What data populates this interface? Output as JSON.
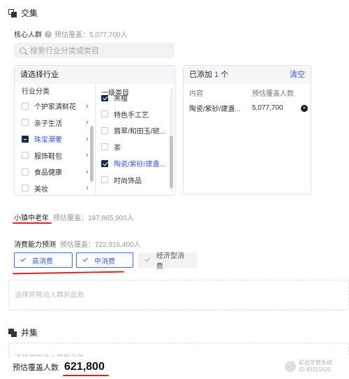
{
  "intersect": {
    "title": "交集"
  },
  "core": {
    "label": "核心人群",
    "help": "?",
    "estimate": "预估覆盖：5,077,700人"
  },
  "search": {
    "placeholder": "搜索行业分类或类目"
  },
  "industry": {
    "header": "请选择行业",
    "col1_title": "行业分类",
    "col1_items": [
      {
        "label": "个护家清鲜花",
        "state": "none"
      },
      {
        "label": "亲子生活",
        "state": "none"
      },
      {
        "label": "珠宝潮奢",
        "state": "indeterminate"
      },
      {
        "label": "服饰鞋包",
        "state": "none"
      },
      {
        "label": "食品健康",
        "state": "none"
      },
      {
        "label": "美妆",
        "state": "none"
      }
    ],
    "col2_title": "一级类目",
    "col2_items": [
      {
        "label": "黑檀",
        "state": "checked"
      },
      {
        "label": "特色手工艺",
        "state": "none"
      },
      {
        "label": "翡翠/和田玉/琥...",
        "state": "none"
      },
      {
        "label": "茶",
        "state": "none"
      },
      {
        "label": "陶瓷/紫砂/建盏...",
        "state": "checked"
      },
      {
        "label": "时尚饰品",
        "state": "none"
      }
    ]
  },
  "added": {
    "prefix": "已添加",
    "count": "1",
    "suffix": "个",
    "clear": "清空",
    "col_content": "内容",
    "col_estimate": "预估覆盖人数",
    "rows": [
      {
        "content": "陶瓷/紫砂/建盏...",
        "estimate": "5,077,700"
      }
    ]
  },
  "town": {
    "label": "小镇中老年",
    "estimate": "预估覆盖：197,865,900人"
  },
  "consume": {
    "label": "消费能力预测",
    "estimate": "预估覆盖：722,916,400人",
    "options": [
      "高消费",
      "中消费",
      "经济型消费"
    ]
  },
  "dropzone": {
    "text": "选择并拖动人群到此处"
  },
  "union": {
    "title": "并集",
    "drop_text": "选择并拖动人群到此处"
  },
  "footer": {
    "label": "预估覆盖人数",
    "value": "621,800"
  },
  "watermark": {
    "line1": "彩社学营系统",
    "line2": "ID:43315620"
  },
  "colors": {
    "accent": "#3b5bdb",
    "annotation": "#d9281f",
    "dark": "#1a2a4a"
  }
}
